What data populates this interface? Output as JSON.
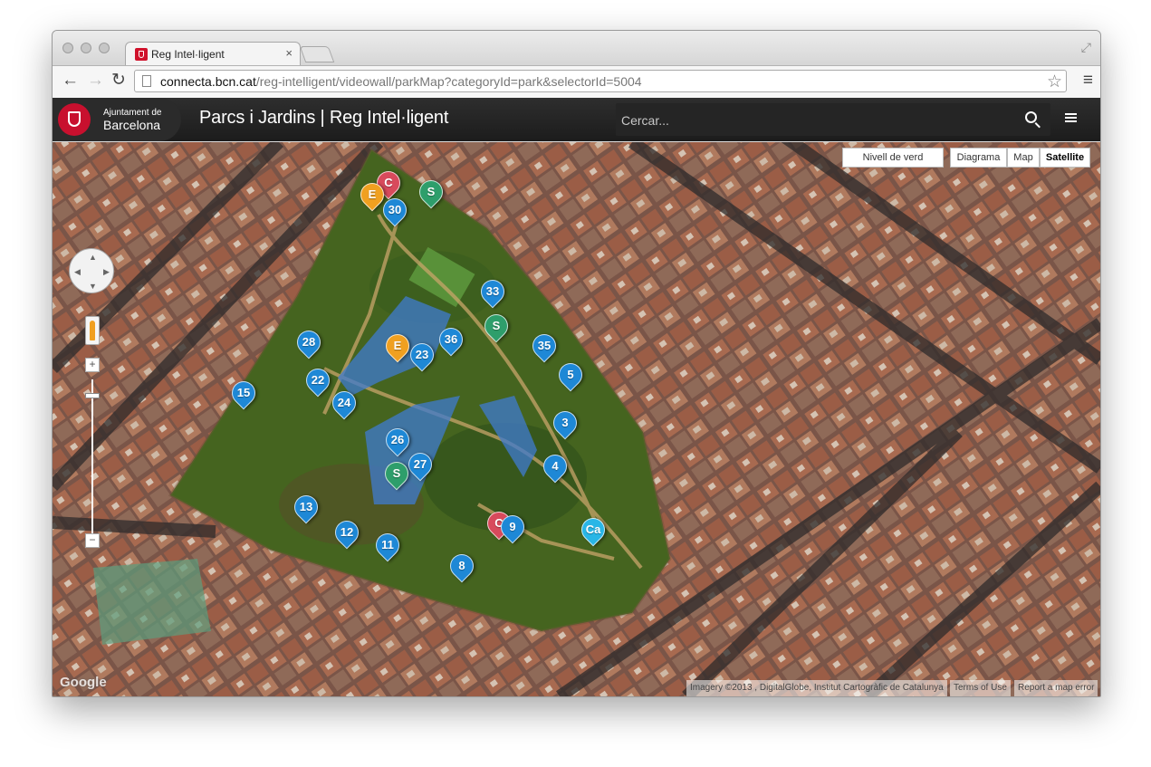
{
  "browser": {
    "tab_title": "Reg Intel·ligent",
    "tab_close": "×",
    "url_host": "connecta.bcn.cat",
    "url_path": "/reg-intelligent/videowall/parkMap?categoryId=park&selectorId=5004"
  },
  "header": {
    "logo_small": "Ajuntament de",
    "logo_big": "Barcelona",
    "title": "Parcs i Jardins | Reg Intel·ligent",
    "search_placeholder": "Cercar..."
  },
  "map": {
    "controls": {
      "nivell_label": "Nivell de verd",
      "types": [
        "Diagrama",
        "Map",
        "Satellite"
      ],
      "active_type": "Satellite",
      "zoom_in": "+",
      "zoom_out": "−"
    },
    "google_logo": "Google",
    "attribution": {
      "imagery": "Imagery ©2013 , DigitalGlobe, Institut Cartogràfic de Catalunya",
      "terms": "Terms of Use",
      "report": "Report a map error"
    },
    "colors": {
      "blue": "#1e88d6",
      "green": "#2e9e6b",
      "orange": "#f0a020",
      "red": "#d84a5c",
      "cyan": "#29b6e6"
    },
    "markers": [
      {
        "label": "C",
        "type": "red"
      },
      {
        "label": "E",
        "type": "orange"
      },
      {
        "label": "S",
        "type": "green"
      },
      {
        "label": "30",
        "type": "blue"
      },
      {
        "label": "33",
        "type": "blue"
      },
      {
        "label": "S",
        "type": "green"
      },
      {
        "label": "28",
        "type": "blue"
      },
      {
        "label": "E",
        "type": "orange"
      },
      {
        "label": "23",
        "type": "blue"
      },
      {
        "label": "36",
        "type": "blue"
      },
      {
        "label": "35",
        "type": "blue"
      },
      {
        "label": "22",
        "type": "blue"
      },
      {
        "label": "15",
        "type": "blue"
      },
      {
        "label": "24",
        "type": "blue"
      },
      {
        "label": "5",
        "type": "blue"
      },
      {
        "label": "3",
        "type": "blue"
      },
      {
        "label": "26",
        "type": "blue"
      },
      {
        "label": "27",
        "type": "blue"
      },
      {
        "label": "S",
        "type": "green"
      },
      {
        "label": "4",
        "type": "blue"
      },
      {
        "label": "13",
        "type": "blue"
      },
      {
        "label": "C",
        "type": "red"
      },
      {
        "label": "9",
        "type": "blue"
      },
      {
        "label": "Ca",
        "type": "cyan"
      },
      {
        "label": "12",
        "type": "blue"
      },
      {
        "label": "11",
        "type": "blue"
      },
      {
        "label": "8",
        "type": "blue"
      }
    ]
  }
}
